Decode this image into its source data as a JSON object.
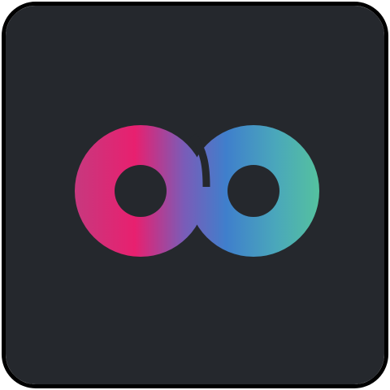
{
  "app_icon": {
    "icon": "infinity-logo-icon",
    "colors": {
      "background": "#25282D",
      "border": "#000000",
      "gradient_stops": [
        "#C6397F",
        "#E8206F",
        "#7A5CB8",
        "#3F7FCC",
        "#4AA7BB",
        "#55C29E"
      ]
    }
  }
}
